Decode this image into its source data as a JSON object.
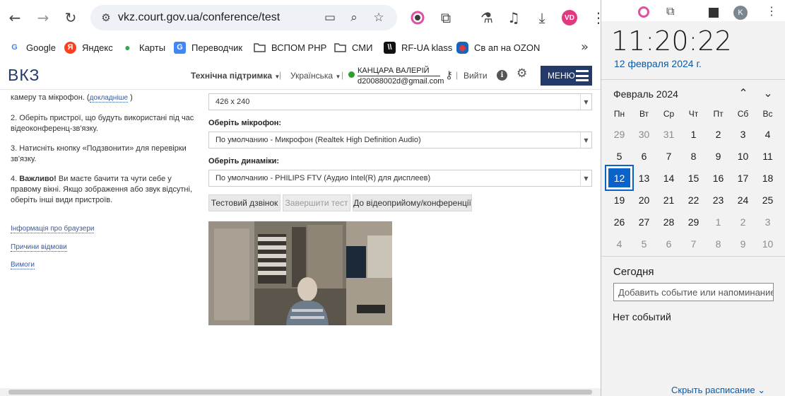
{
  "browser": {
    "url": "vkz.court.gov.ua/conference/test",
    "profile_initials": "VD",
    "bookmarks": [
      {
        "label": "Google",
        "icon": "G",
        "color": "#4285f4"
      },
      {
        "label": "Яндекс",
        "icon": "Я",
        "color": "#fc3f1d"
      },
      {
        "label": "Карты",
        "icon": "●",
        "color": "#34a853"
      },
      {
        "label": "Переводчик",
        "icon": "G",
        "color": "#4285f4"
      },
      {
        "label": "ВСПОМ PHP",
        "icon": "folder-icon",
        "color": "#444444"
      },
      {
        "label": "СМИ",
        "icon": "folder-icon",
        "color": "#444444"
      },
      {
        "label": "RF-UA klass",
        "icon": "\\\\",
        "color": "#111111"
      },
      {
        "label": "Св ап на OZON",
        "icon": "◉",
        "color": "#1565c0"
      }
    ]
  },
  "site": {
    "logo": "ВКЗ",
    "support_label": "Технічна підтримка",
    "language_label": "Українська",
    "separator": "|",
    "user_name": "КАНЦАРА ВАЛЕРІЙ",
    "user_email": "d20088002d@gmail.com",
    "logout_label": "Вийти",
    "menu_label": "МЕНЮ"
  },
  "instructions": {
    "p1_text": "камеру та мікрофон. (",
    "p1_link": "докладніше",
    "p1_end": " )",
    "p2": "2. Оберіть пристрої, що будуть використані під час відеоконференц-зв'язку.",
    "p3": "3. Натисніть кнопку «Подзвонити» для перевірки зв'язку.",
    "p4_bold": "Важливо!",
    "p4_num": "4. ",
    "p4_rest": " Ви маєте бачити та чути себе у правому вікні. Якщо зображення або звук відсутні, оберіть інші види пристроїв.",
    "links": [
      "Інформація про браузери",
      "Причини відмови",
      "Вимоги"
    ]
  },
  "form": {
    "camera_value": "426 x 240",
    "mic_label": "Оберіть мікрофон:",
    "mic_value": "По умолчанию - Микрофон (Realtek High Definition Audio)",
    "speakers_label": "Оберіть динаміки:",
    "speakers_value": "По умолчанию - PHILIPS FTV (Аудио Intel(R) для дисплеев)",
    "btn_test_call": "Тестовий дзвінок",
    "btn_end_test": "Завершити тест",
    "btn_to_conference": "До відеоприйому/конференції"
  },
  "flyout": {
    "time": "11:20:22",
    "date": "12 февраля 2024 г.",
    "month": "Февраль 2024",
    "weekdays": [
      "Пн",
      "Вт",
      "Ср",
      "Чт",
      "Пт",
      "Сб",
      "Вс"
    ],
    "weeks": [
      [
        "29",
        "30",
        "31",
        "1",
        "2",
        "3",
        "4"
      ],
      [
        "5",
        "6",
        "7",
        "8",
        "9",
        "10",
        "11"
      ],
      [
        "12",
        "13",
        "14",
        "15",
        "16",
        "17",
        "18"
      ],
      [
        "19",
        "20",
        "21",
        "22",
        "23",
        "24",
        "25"
      ],
      [
        "26",
        "27",
        "28",
        "29",
        "1",
        "2",
        "3"
      ],
      [
        "4",
        "5",
        "6",
        "7",
        "8",
        "9",
        "10"
      ]
    ],
    "today_label": "Сегодня",
    "event_placeholder": "Добавить событие или напоминание",
    "no_events": "Нет событий",
    "schedule_link": "Скрыть расписание"
  },
  "colors": {
    "accent_blue": "#0a63c9",
    "brand_navy": "#243a6b",
    "link_blue": "#0a5aa8",
    "online_green": "#2aa12a"
  }
}
